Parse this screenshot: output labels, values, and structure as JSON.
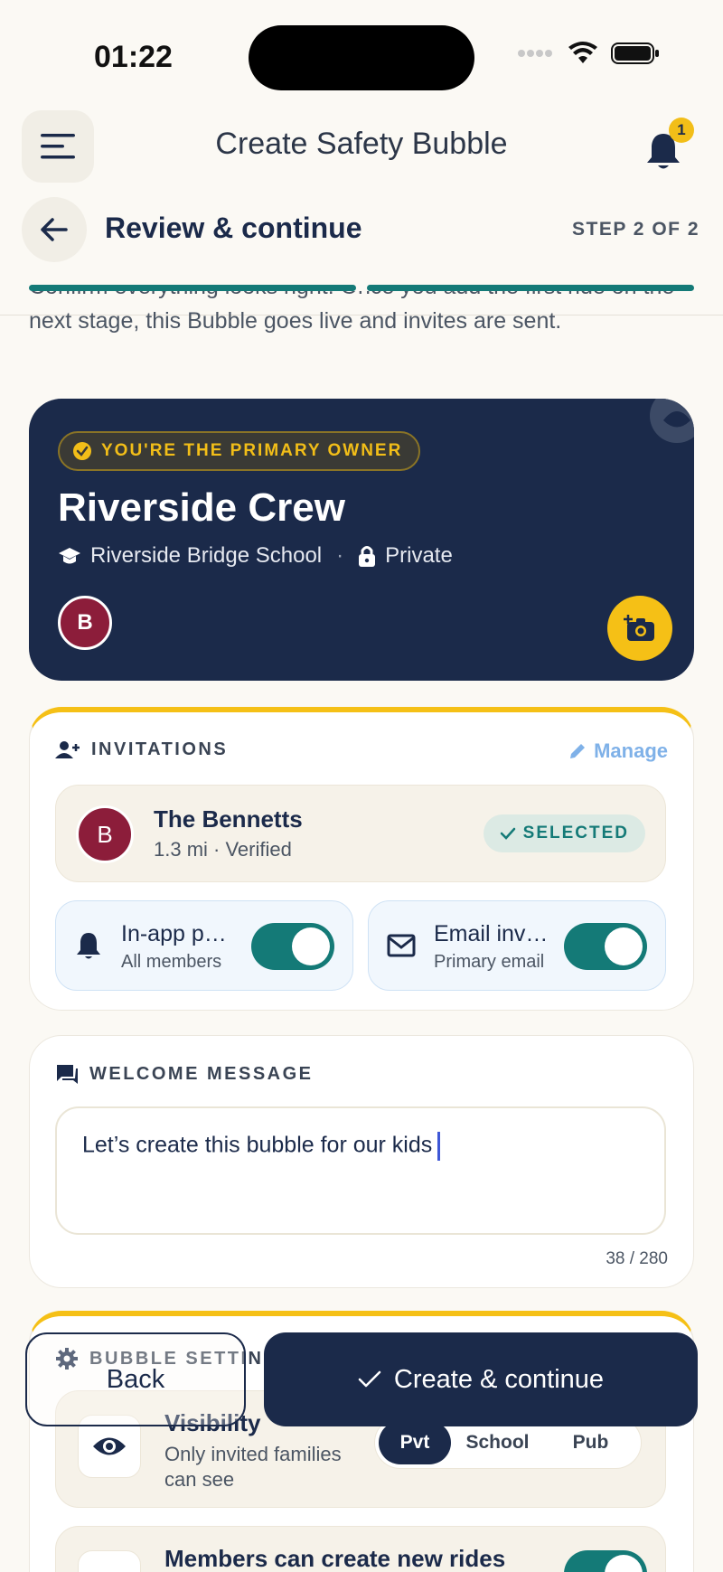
{
  "status": {
    "time": "01:22"
  },
  "header": {
    "title": "Create Safety Bubble",
    "notifications": "1"
  },
  "step": {
    "title": "Review & continue",
    "count": "STEP 2 OF 2"
  },
  "intro": "Confirm everything looks right. Once you add the first ride on the next stage, this Bubble goes live and invites are sent.",
  "bubble": {
    "owner_badge": "YOU'RE THE PRIMARY OWNER",
    "name": "Riverside Crew",
    "school": "Riverside Bridge School",
    "privacy": "Private",
    "avatar": "B"
  },
  "invitations": {
    "heading": "INVITATIONS",
    "manage": "Manage",
    "family": {
      "avatar": "B",
      "name": "The Bennetts",
      "sub": "1.3 mi · Verified",
      "status": "SELECTED"
    },
    "push": {
      "title": "In-app push notifications",
      "sub": "All members",
      "on": true
    },
    "email": {
      "title": "Email invitations",
      "sub": "Primary email",
      "on": true
    }
  },
  "welcome": {
    "heading": "WELCOME MESSAGE",
    "message": "Let’s create this bubble for our kids",
    "counter": "38 / 280"
  },
  "settings": {
    "heading": "BUBBLE SETTINGS",
    "visibility": {
      "title": "Visibility",
      "sub": "Only invited families can see",
      "options": [
        "Pvt",
        "School",
        "Pub"
      ],
      "selected": "Pvt"
    },
    "rides": {
      "title": "Members can create new rides"
    }
  },
  "actions": {
    "back": "Back",
    "create": "Create & continue"
  },
  "colors": {
    "navy": "#1B2A4A",
    "teal": "#147A77",
    "gold": "#F5C016",
    "maroon": "#8C1D3A"
  }
}
